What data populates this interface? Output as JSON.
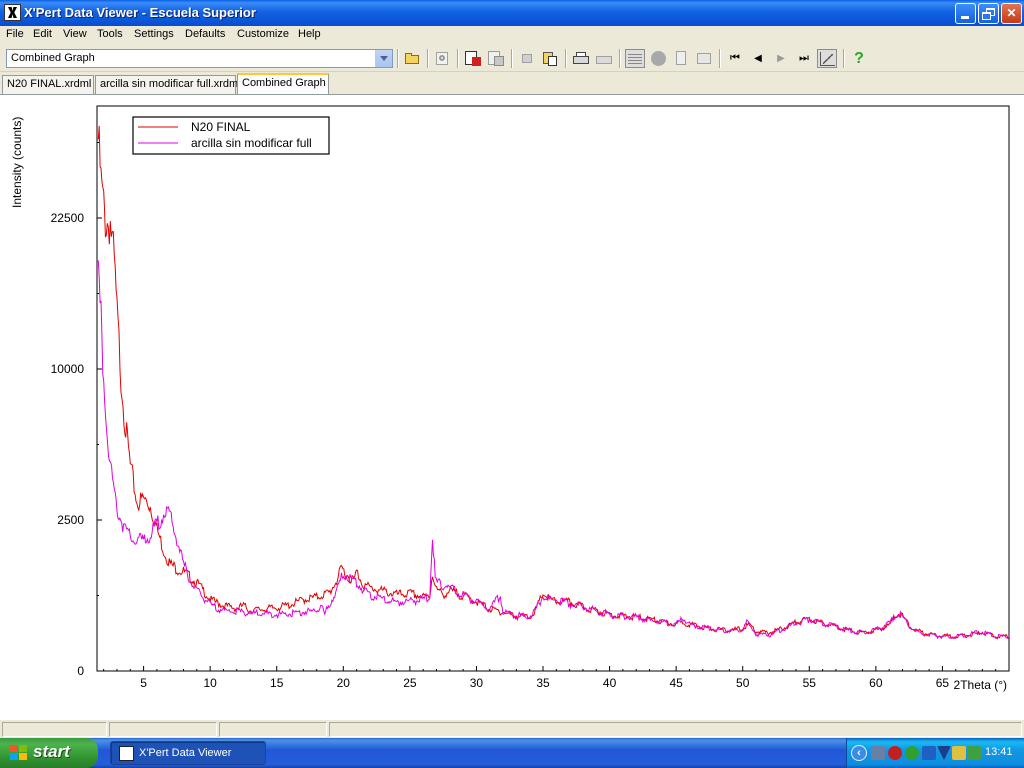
{
  "window": {
    "title": "X'Pert Data Viewer - Escuela Superior"
  },
  "menu": [
    "File",
    "Edit",
    "View",
    "Tools",
    "Settings",
    "Defaults",
    "Customize",
    "Help"
  ],
  "toolbar": {
    "graph_select_value": "Combined Graph",
    "icons": [
      "open-folder-icon",
      "refresh-icon",
      "graph-add-icon",
      "graph-copy-icon",
      "copy-icon",
      "paste-icon",
      "print-icon",
      "print-preview-icon",
      "grid-icon",
      "circle-icon",
      "document-icon",
      "list-icon",
      "first-icon",
      "previous-icon",
      "next-icon",
      "last-icon",
      "peak-icon",
      "help-icon"
    ]
  },
  "tabs": [
    {
      "label": "N20 FINAL.xrdml",
      "active": false
    },
    {
      "label": "arcilla sin modificar full.xrdml",
      "active": false
    },
    {
      "label": "Combined Graph",
      "active": true
    }
  ],
  "chart_data": {
    "type": "line",
    "xlabel": "2Theta (°)",
    "ylabel": "Intensity (counts)",
    "xlim": [
      1.5,
      70
    ],
    "y_scale": "square-root",
    "ylim": [
      0,
      35000
    ],
    "x_ticks": [
      5,
      10,
      15,
      20,
      25,
      30,
      35,
      40,
      45,
      50,
      55,
      60,
      65
    ],
    "y_ticks": [
      0,
      2500,
      10000,
      22500
    ],
    "legend_position": "top-left",
    "series": [
      {
        "name": "N20 FINAL",
        "color": "#e00000",
        "x": [
          1.6,
          1.8,
          2.0,
          2.2,
          2.5,
          2.8,
          3.0,
          3.3,
          3.6,
          4.0,
          4.5,
          5.0,
          5.5,
          6.0,
          6.5,
          7.0,
          7.5,
          8.0,
          9.0,
          10.0,
          11.0,
          12.0,
          12.5,
          13.0,
          14.0,
          15.0,
          16.0,
          17.0,
          18.0,
          19.0,
          19.5,
          19.9,
          20.3,
          20.8,
          21.0,
          21.5,
          22.0,
          23.0,
          24.0,
          25.0,
          26.0,
          26.5,
          26.7,
          27.0,
          27.5,
          28.0,
          29.0,
          30.0,
          31.0,
          32.0,
          33.0,
          34.0,
          34.5,
          35.0,
          35.5,
          36.0,
          37.0,
          38.0,
          39.0,
          40.0,
          41.0,
          42.0,
          43.0,
          44.0,
          45.0,
          45.5,
          46.0,
          47.0,
          48.0,
          49.0,
          50.0,
          50.5,
          51.0,
          52.0,
          53.0,
          54.0,
          55.0,
          56.0,
          57.0,
          58.0,
          59.0,
          60.0,
          61.0,
          61.7,
          62.5,
          63.0,
          64.0,
          65.0,
          66.0,
          67.0,
          68.0,
          69.0,
          70.0
        ],
        "y": [
          31000,
          26000,
          23500,
          22000,
          22200,
          18000,
          14000,
          9500,
          6800,
          4600,
          3100,
          3250,
          3000,
          2200,
          1600,
          1250,
          1150,
          1080,
          850,
          560,
          470,
          430,
          470,
          400,
          420,
          440,
          480,
          560,
          600,
          680,
          900,
          1150,
          1000,
          900,
          1080,
          820,
          760,
          700,
          640,
          660,
          600,
          620,
          1050,
          720,
          640,
          700,
          620,
          530,
          420,
          380,
          330,
          320,
          420,
          660,
          560,
          530,
          520,
          450,
          400,
          350,
          330,
          320,
          300,
          260,
          240,
          260,
          240,
          210,
          190,
          180,
          200,
          240,
          170,
          160,
          200,
          260,
          300,
          250,
          220,
          180,
          160,
          180,
          230,
          380,
          230,
          180,
          150,
          140,
          130,
          140,
          160,
          130,
          130
        ]
      },
      {
        "name": "arcilla sin modificar full",
        "color": "#e000e0",
        "x": [
          1.6,
          1.8,
          2.0,
          2.3,
          2.6,
          3.0,
          3.5,
          4.0,
          4.5,
          5.0,
          5.5,
          6.0,
          6.5,
          6.8,
          7.0,
          7.5,
          8.0,
          8.5,
          9.0,
          10.0,
          11.0,
          12.0,
          13.0,
          14.0,
          15.0,
          16.0,
          17.0,
          18.0,
          18.3,
          18.6,
          19.0,
          19.5,
          20.0,
          20.5,
          21.0,
          21.5,
          22.0,
          23.0,
          24.0,
          25.0,
          26.0,
          26.5,
          26.7,
          26.9,
          27.5,
          27.8,
          28.0,
          29.0,
          30.0,
          31.0,
          31.8,
          32.0,
          33.0,
          34.0,
          34.5,
          35.0,
          35.5,
          36.0,
          37.0,
          38.0,
          39.0,
          40.0,
          41.0,
          42.0,
          43.0,
          44.0,
          45.0,
          45.5,
          46.0,
          47.0,
          48.0,
          49.0,
          50.0,
          50.3,
          51.0,
          52.0,
          53.0,
          54.0,
          55.0,
          56.0,
          57.0,
          58.0,
          59.0,
          60.0,
          61.0,
          61.7,
          62.5,
          63.0,
          64.0,
          65.0,
          66.0,
          67.0,
          68.0,
          69.0,
          70.0
        ],
        "y": [
          17500,
          13500,
          9500,
          6000,
          4200,
          2900,
          2300,
          1950,
          1850,
          1900,
          2000,
          2350,
          2700,
          2750,
          2600,
          1900,
          1250,
          900,
          700,
          480,
          400,
          390,
          370,
          360,
          350,
          360,
          380,
          400,
          480,
          350,
          500,
          700,
          1050,
          950,
          850,
          720,
          640,
          560,
          520,
          540,
          560,
          620,
          1900,
          900,
          780,
          850,
          760,
          630,
          520,
          420,
          620,
          380,
          340,
          320,
          420,
          620,
          540,
          560,
          500,
          450,
          400,
          350,
          330,
          320,
          280,
          260,
          240,
          300,
          240,
          210,
          190,
          180,
          180,
          260,
          150,
          140,
          190,
          250,
          290,
          250,
          220,
          180,
          160,
          190,
          250,
          370,
          230,
          170,
          140,
          130,
          130,
          150,
          170,
          130,
          130
        ]
      }
    ]
  },
  "taskbar": {
    "start_label": "start",
    "task_label": "X'Pert Data Viewer",
    "clock": "13:41",
    "tray_icons": [
      "network-icon",
      "security-icon",
      "antivirus-icon",
      "update-icon",
      "shield-icon",
      "vpn-icon",
      "device-icon"
    ]
  }
}
